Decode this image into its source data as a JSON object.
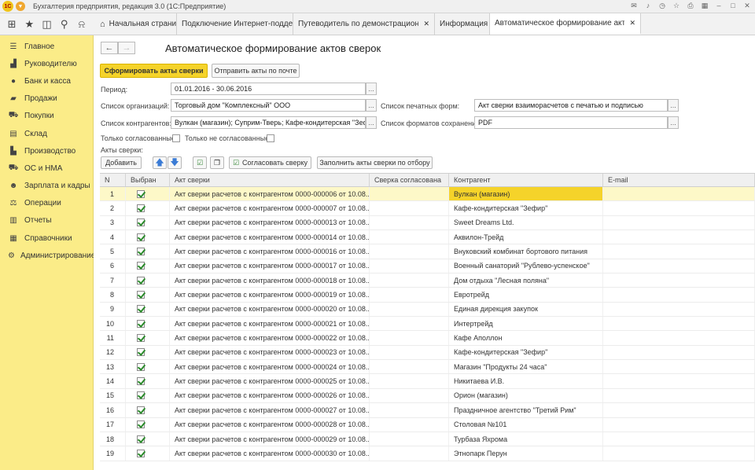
{
  "window": {
    "title": "Бухгалтерия предприятия, редакция 3.0  (1С:Предприятие)",
    "logo_text": "1С"
  },
  "tabs": [
    {
      "label": "Начальная страница",
      "closable": false
    },
    {
      "label": "Подключение Интернет-поддержки",
      "closable": true
    },
    {
      "label": "Путеводитель по демонстрационной базе",
      "closable": true
    },
    {
      "label": "Информация",
      "closable": true
    },
    {
      "label": "Автоматическое формирование актов сверок",
      "closable": true
    }
  ],
  "sidebar": {
    "items": [
      {
        "label": "Главное",
        "icon": "menu-icon"
      },
      {
        "label": "Руководителю",
        "icon": "chart-icon"
      },
      {
        "label": "Банк и касса",
        "icon": "coin-icon"
      },
      {
        "label": "Продажи",
        "icon": "bag-icon"
      },
      {
        "label": "Покупки",
        "icon": "cart-icon"
      },
      {
        "label": "Склад",
        "icon": "warehouse-icon"
      },
      {
        "label": "Производство",
        "icon": "factory-icon"
      },
      {
        "label": "ОС и НМА",
        "icon": "truck-icon"
      },
      {
        "label": "Зарплата и кадры",
        "icon": "people-icon"
      },
      {
        "label": "Операции",
        "icon": "operations-icon"
      },
      {
        "label": "Отчеты",
        "icon": "report-icon"
      },
      {
        "label": "Справочники",
        "icon": "book-icon"
      },
      {
        "label": "Администрирование",
        "icon": "gear-icon"
      }
    ]
  },
  "page": {
    "title": "Автоматическое формирование актов сверок",
    "btn_generate": "Сформировать акты сверки",
    "btn_send": "Отправить акты по почте",
    "period_label": "Период:",
    "period_value": "01.01.2016 - 30.06.2016",
    "orgs_label": "Список организаций:",
    "orgs_value": "Торговый дом \"Комплексный\" ООО",
    "contractors_label": "Список контрагентов:",
    "contractors_value": "Вулкан (магазин); Суприм-Тверь; Кафе-кондитерская \"Зефир\"; Ка",
    "print_forms_label": "Список печатных форм:",
    "print_forms_value": "Акт сверки взаиморасчетов с печатью и подписью",
    "save_formats_label": "Список форматов сохранения:",
    "save_formats_value": "PDF",
    "only_agreed_label": "Только согласованные:",
    "only_not_agreed_label": "Только не согласованные:",
    "acts_label": "Акты сверки:",
    "btn_add": "Добавить",
    "btn_agree": "Согласовать сверку",
    "btn_fill": "Заполнить акты сверки по отбору",
    "ellipsis": "..."
  },
  "table": {
    "columns": [
      "N",
      "Выбран",
      "Акт сверки",
      "Сверка согласована",
      "Контрагент",
      "E-mail"
    ],
    "rows": [
      {
        "n": "1",
        "act": "Акт сверки расчетов с контрагентом 0000-000006 от 10.08....",
        "contractor": "Вулкан (магазин)"
      },
      {
        "n": "2",
        "act": "Акт сверки расчетов с контрагентом 0000-000007 от 10.08....",
        "contractor": "Кафе-кондитерская \"Зефир\""
      },
      {
        "n": "3",
        "act": "Акт сверки расчетов с контрагентом 0000-000013 от 10.08....",
        "contractor": "Sweet Dreams Ltd."
      },
      {
        "n": "4",
        "act": "Акт сверки расчетов с контрагентом 0000-000014 от 10.08....",
        "contractor": "Аквилон-Трейд"
      },
      {
        "n": "5",
        "act": "Акт сверки расчетов с контрагентом 0000-000016 от 10.08....",
        "contractor": "Внуковский комбинат бортового питания"
      },
      {
        "n": "6",
        "act": "Акт сверки расчетов с контрагентом 0000-000017 от 10.08....",
        "contractor": "Военный санаторий \"Рублево-успенское\""
      },
      {
        "n": "7",
        "act": "Акт сверки расчетов с контрагентом 0000-000018 от 10.08....",
        "contractor": "Дом отдыха \"Лесная поляна\""
      },
      {
        "n": "8",
        "act": "Акт сверки расчетов с контрагентом 0000-000019 от 10.08....",
        "contractor": "Евротрейд"
      },
      {
        "n": "9",
        "act": "Акт сверки расчетов с контрагентом 0000-000020 от 10.08....",
        "contractor": "Единая дирекция закупок"
      },
      {
        "n": "10",
        "act": "Акт сверки расчетов с контрагентом 0000-000021 от 10.08....",
        "contractor": "Интертрейд"
      },
      {
        "n": "11",
        "act": "Акт сверки расчетов с контрагентом 0000-000022 от 10.08....",
        "contractor": "Кафе Аполлон"
      },
      {
        "n": "12",
        "act": "Акт сверки расчетов с контрагентом 0000-000023 от 10.08....",
        "contractor": "Кафе-кондитерская \"Зефир\""
      },
      {
        "n": "13",
        "act": "Акт сверки расчетов с контрагентом 0000-000024 от 10.08....",
        "contractor": "Магазин \"Продукты 24 часа\""
      },
      {
        "n": "14",
        "act": "Акт сверки расчетов с контрагентом 0000-000025 от 10.08....",
        "contractor": "Никитаева И.В."
      },
      {
        "n": "15",
        "act": "Акт сверки расчетов с контрагентом 0000-000026 от 10.08....",
        "contractor": "Орион (магазин)"
      },
      {
        "n": "16",
        "act": "Акт сверки расчетов с контрагентом 0000-000027 от 10.08....",
        "contractor": "Праздничное агентство \"Третий Рим\""
      },
      {
        "n": "17",
        "act": "Акт сверки расчетов с контрагентом 0000-000028 от 10.08....",
        "contractor": "Столовая №101"
      },
      {
        "n": "18",
        "act": "Акт сверки расчетов с контрагентом 0000-000029 от 10.08....",
        "contractor": "Турбаза Яхрома"
      },
      {
        "n": "19",
        "act": "Акт сверки расчетов с контрагентом 0000-000030 от 10.08....",
        "contractor": "Этнопарк Перун"
      }
    ]
  },
  "colors": {
    "sidebar_bg": "#fbec88",
    "primary_button": "#f5d32a",
    "selected_row": "#fdf8c8"
  }
}
